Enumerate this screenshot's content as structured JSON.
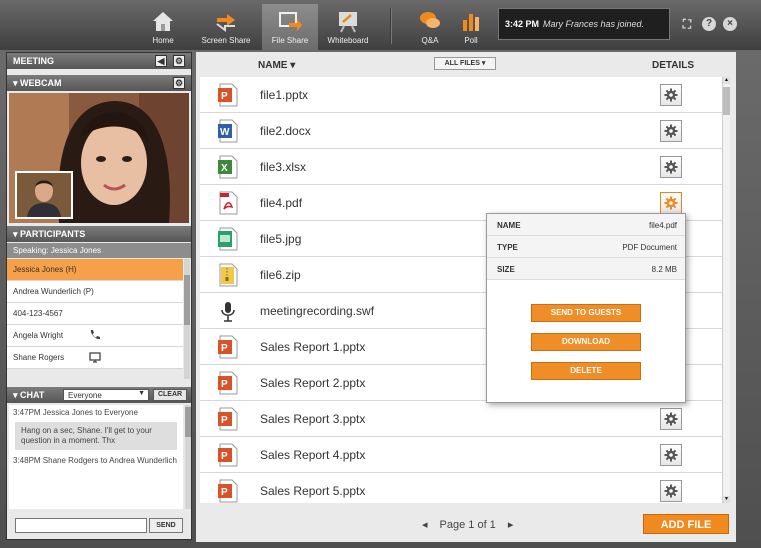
{
  "toolbar": {
    "tools": [
      {
        "label": "Home",
        "icon": "home-icon"
      },
      {
        "label": "Screen Share",
        "icon": "screen-share-icon"
      },
      {
        "label": "File Share",
        "icon": "file-share-icon",
        "active": true
      },
      {
        "label": "Whiteboard",
        "icon": "whiteboard-icon"
      },
      {
        "label": "Q&A",
        "icon": "qa-icon"
      },
      {
        "label": "Poll",
        "icon": "poll-icon"
      }
    ],
    "notice_time": "3:42 PM",
    "notice_text": "Mary Frances has joined."
  },
  "meeting": {
    "title": "MEETING",
    "webcam_title": "WEBCAM",
    "participants_title": "PARTICIPANTS",
    "speaking": "Speaking: Jessica Jones",
    "participants": [
      {
        "name": "Jessica Jones (H)",
        "selected": true
      },
      {
        "name": "Andrea Wunderlich (P)"
      },
      {
        "name": "404-123-4567"
      },
      {
        "name": "Angela Wright",
        "icon": "phone-icon"
      },
      {
        "name": "Shane Rogers",
        "icon": "monitor-icon"
      }
    ]
  },
  "chat": {
    "title": "CHAT",
    "recipient": "Everyone",
    "clear_label": "CLEAR",
    "messages": [
      {
        "header": "3:47PM Jessica Jones to Everyone",
        "body": "Hang on a sec, Shane. I'll get to your question in a moment. Thx"
      },
      {
        "header": "3:48PM Shane Rodgers to Andrea Wunderlich",
        "body": ""
      }
    ],
    "send_label": "SEND"
  },
  "files": {
    "name_header": "NAME",
    "filter_label": "ALL FILES",
    "details_header": "DETAILS",
    "items": [
      {
        "name": "file1.pptx",
        "type": "pptx"
      },
      {
        "name": "file2.docx",
        "type": "docx"
      },
      {
        "name": "file3.xlsx",
        "type": "xlsx"
      },
      {
        "name": "file4.pdf",
        "type": "pdf"
      },
      {
        "name": "file5.jpg",
        "type": "jpg"
      },
      {
        "name": "file6.zip",
        "type": "zip"
      },
      {
        "name": "meetingrecording.swf",
        "type": "swf"
      },
      {
        "name": "Sales Report 1.pptx",
        "type": "pptx"
      },
      {
        "name": "Sales Report 2.pptx",
        "type": "pptx"
      },
      {
        "name": "Sales Report 3.pptx",
        "type": "pptx"
      },
      {
        "name": "Sales Report 4.pptx",
        "type": "pptx"
      },
      {
        "name": "Sales Report 5.pptx",
        "type": "pptx"
      }
    ],
    "pager": "Page 1 of 1",
    "add_file_label": "ADD FILE"
  },
  "details": {
    "name_label": "NAME",
    "name_value": "file4.pdf",
    "type_label": "TYPE",
    "type_value": "PDF Document",
    "size_label": "SIZE",
    "size_value": "8.2 MB",
    "send_label": "SEND TO GUESTS",
    "download_label": "DOWNLOAD",
    "delete_label": "DELETE"
  },
  "colors": {
    "accent": "#f08a1f",
    "selected_row": "#f7a04a",
    "toolbar": "#4f4f4f"
  }
}
